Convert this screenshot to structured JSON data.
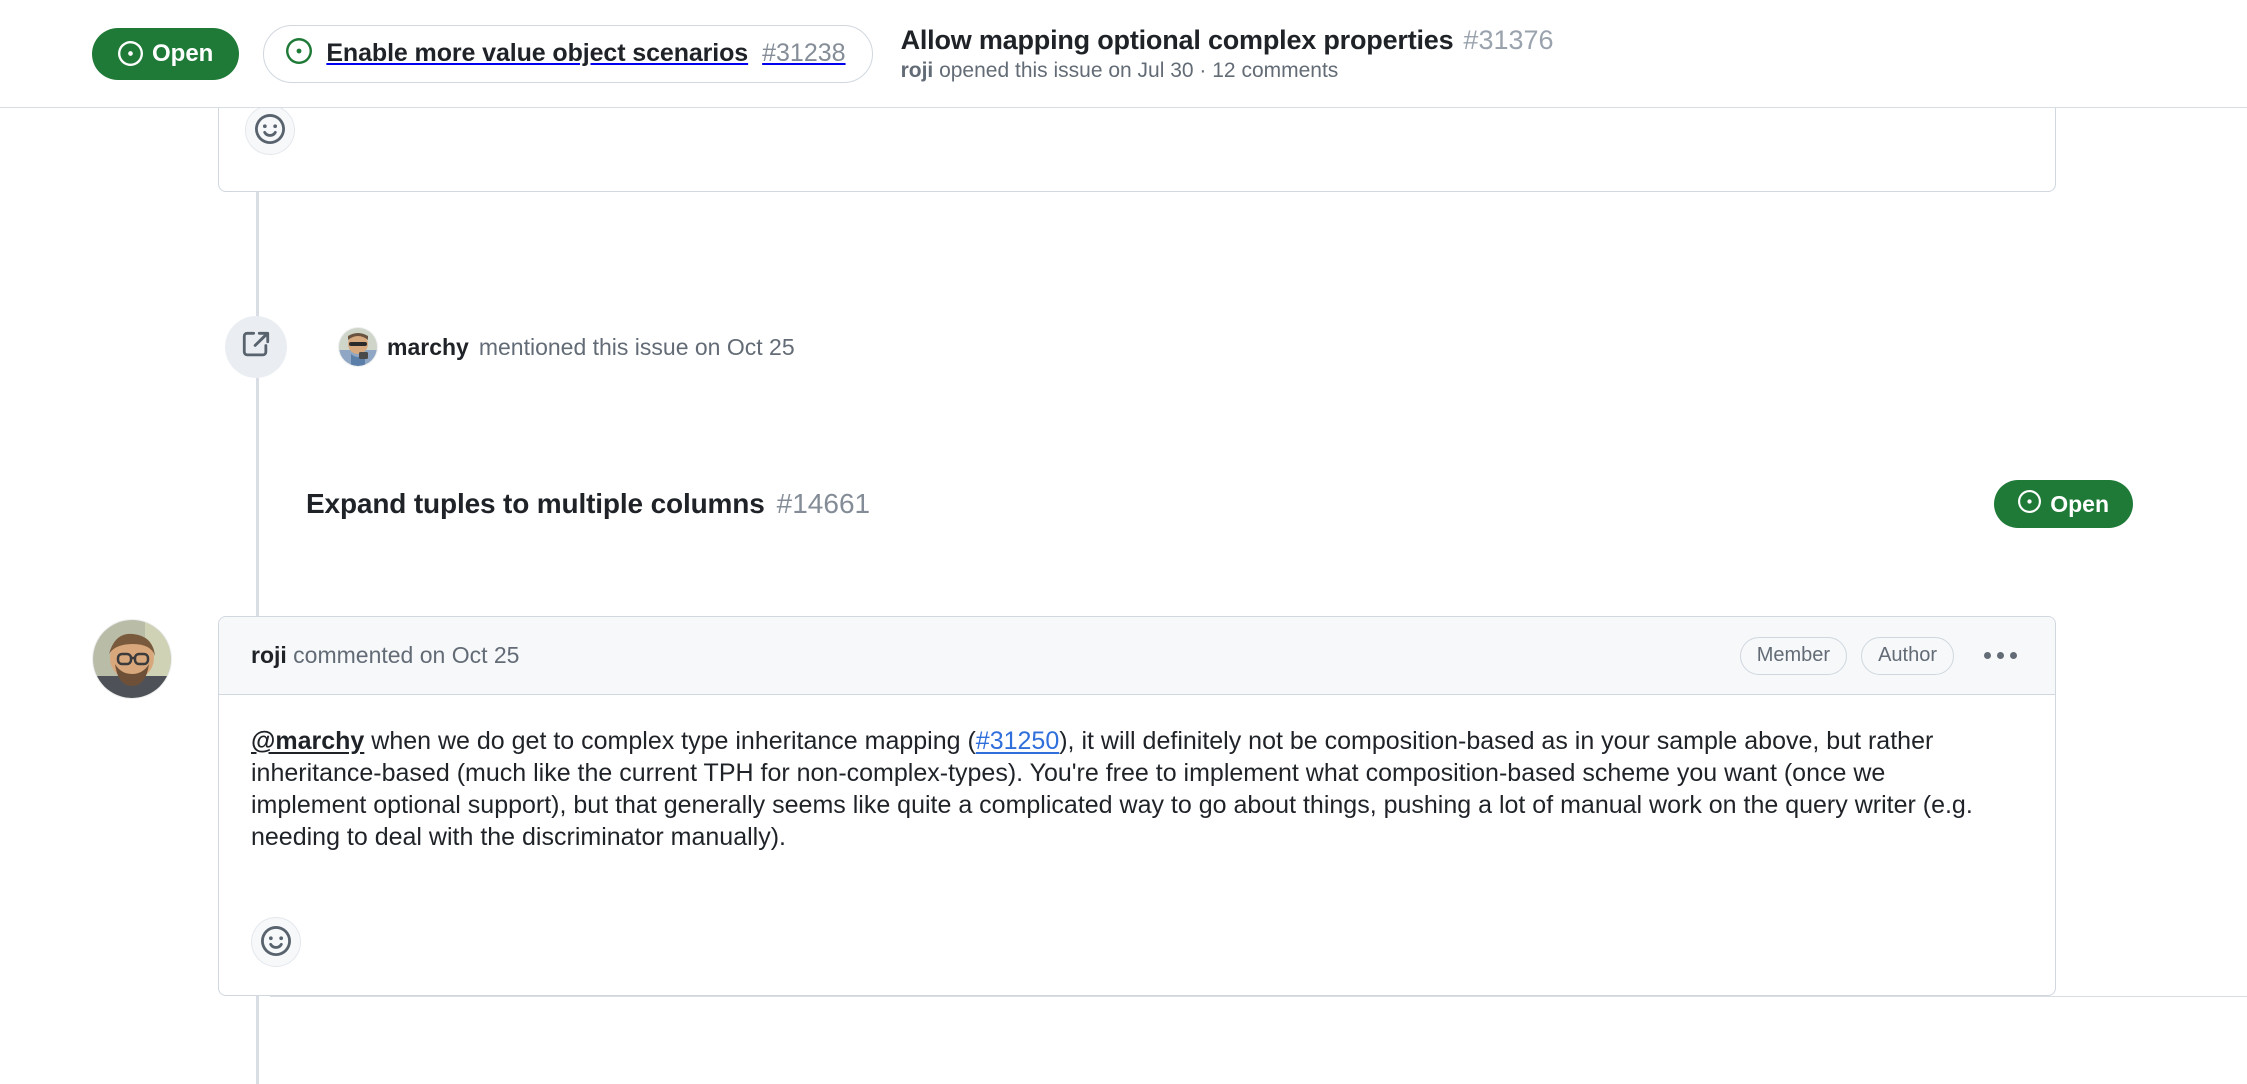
{
  "header": {
    "state_label": "Open",
    "state_icon": "issue-opened-icon",
    "state_color": "#1f7a38",
    "chip": {
      "icon": "issue-opened-icon",
      "title": "Enable more value object scenarios",
      "number": "#31238"
    },
    "title": "Allow mapping optional complex properties",
    "number": "#31376",
    "sub_author": "roji",
    "sub_rest": "opened this issue on Jul 30 · 12 comments"
  },
  "timeline": {
    "top_comment": {
      "reaction_icon": "smiley-icon"
    },
    "mention_event": {
      "icon": "cross-reference-icon",
      "avatar_alt": "marchy-avatar",
      "username": "marchy",
      "text": "mentioned this issue on Oct 25"
    },
    "referenced_issue": {
      "title": "Expand tuples to multiple columns",
      "number": "#14661",
      "state_label": "Open",
      "state_icon": "issue-opened-icon"
    },
    "comment": {
      "avatar_alt": "roji-avatar",
      "username": "roji",
      "meta": "commented on Oct 25",
      "badges": [
        "Member",
        "Author"
      ],
      "kebab_icon": "kebab-horizontal-icon",
      "reaction_icon": "smiley-icon",
      "body": {
        "mention": "@marchy",
        "part1": " when we do get to complex type inheritance mapping (",
        "link": "#31250",
        "part2": "), it will definitely not be composition-based as in your sample above, but rather inheritance-based (much like the current TPH for non-complex-types). You're free to implement what composition-based scheme you want (once we implement optional support), but that generally seems like quite a complicated way to go about things, pushing a lot of manual work on the query writer (e.g. needing to deal with the discriminator manually)."
      }
    }
  }
}
